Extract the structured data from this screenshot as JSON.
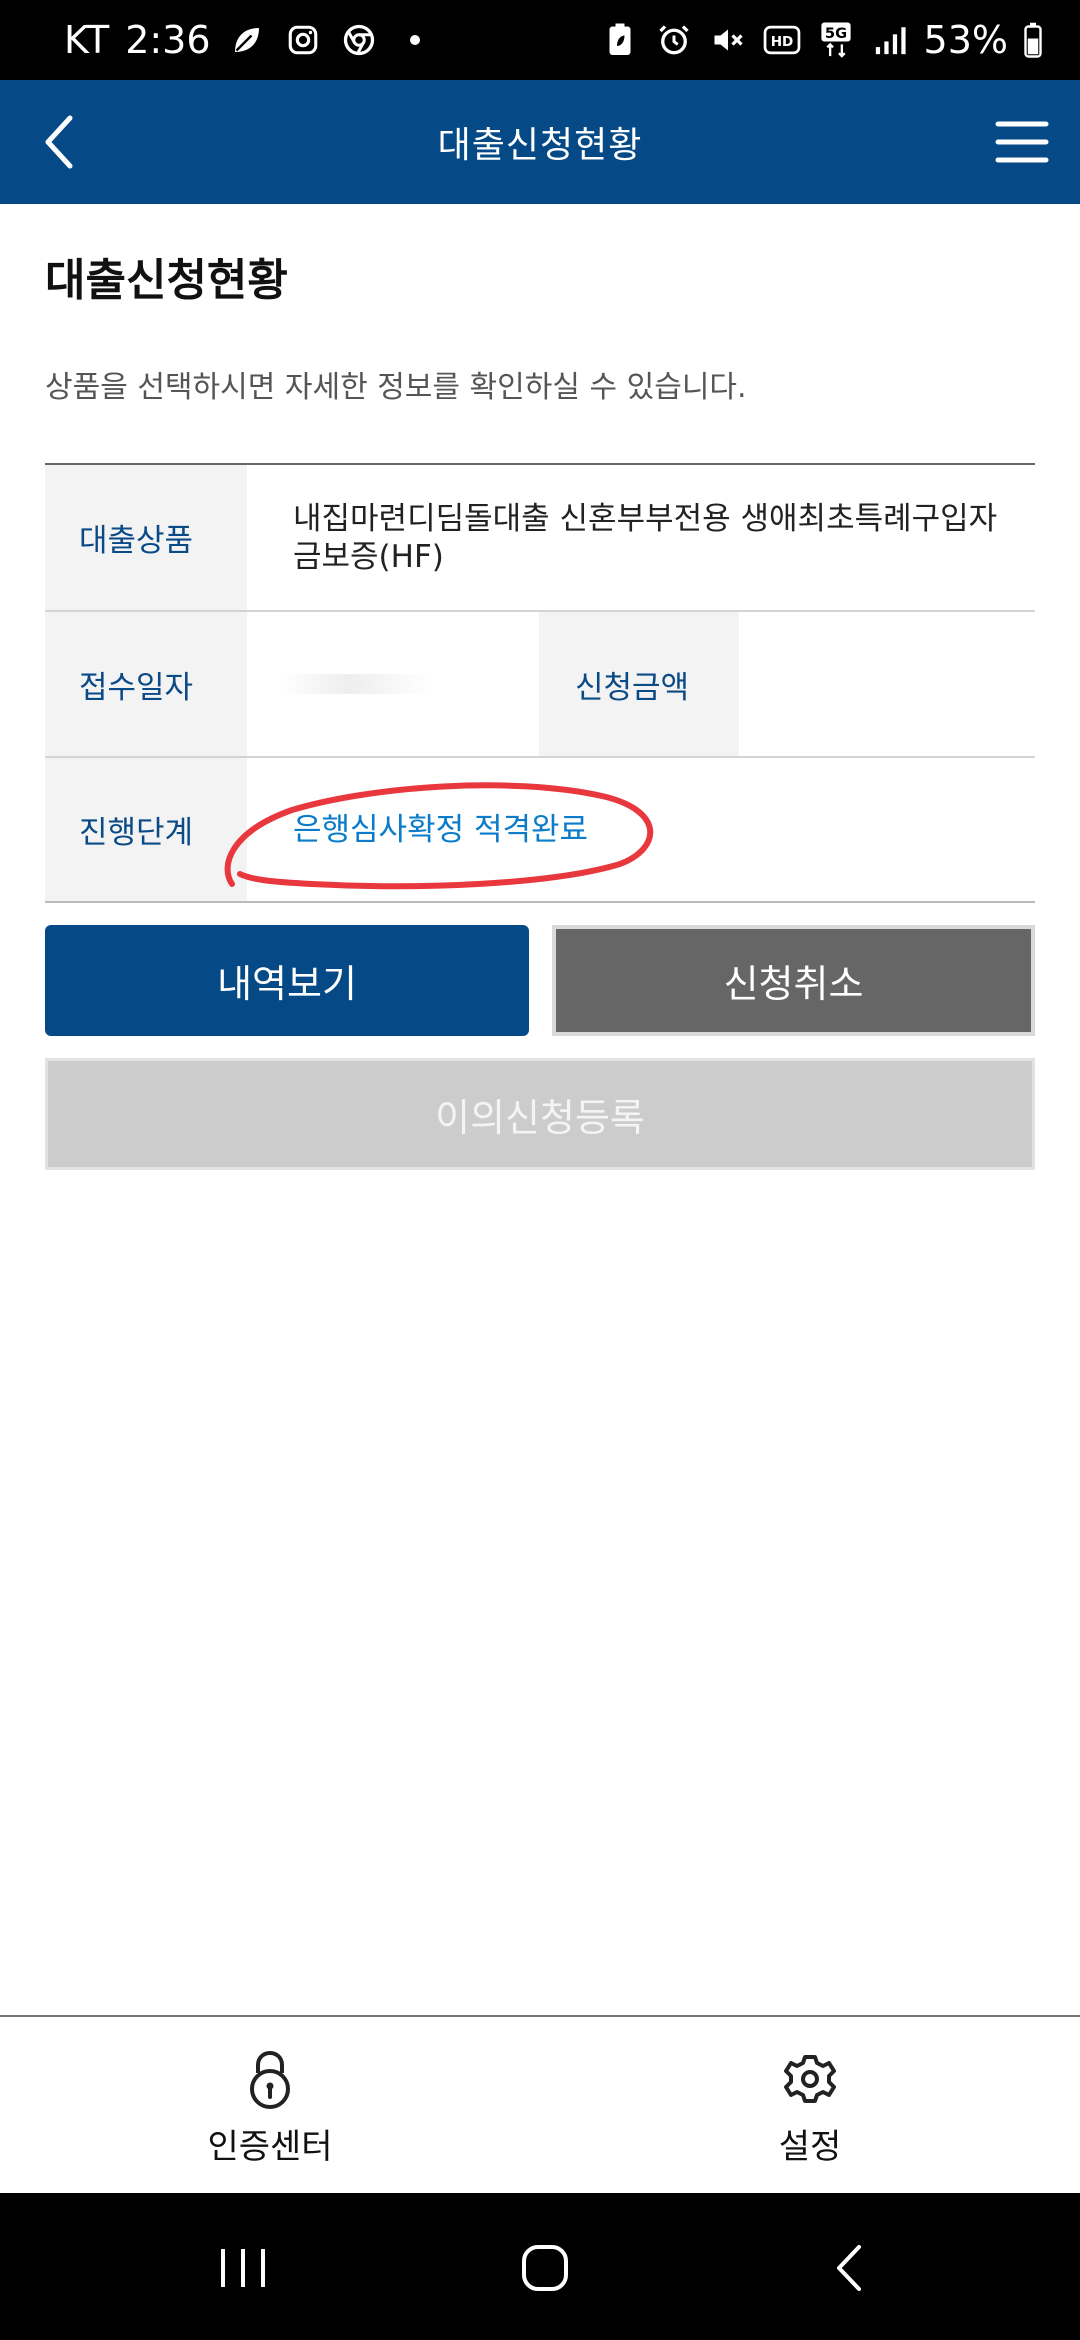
{
  "status_bar": {
    "carrier": "KT",
    "time": "2:36",
    "battery": "53%",
    "left_icons": [
      "leaf-icon",
      "instagram-icon",
      "chrome-icon",
      "dot-icon"
    ],
    "right_icons": [
      "battery-saver-icon",
      "alarm-icon",
      "mute-icon",
      "hd-icon",
      "5g-icon",
      "signal-icon",
      "battery-icon"
    ]
  },
  "header": {
    "title": "대출신청현황",
    "back_icon": "chevron-left-icon",
    "menu_icon": "hamburger-menu-icon"
  },
  "page": {
    "title": "대출신청현황",
    "description": "상품을 선택하시면 자세한 정보를 확인하실 수 있습니다."
  },
  "details": {
    "product_label": "대출상품",
    "product_value": "내집마련디딤돌대출 신혼부부전용 생애최초특례구입자금보증(HF)",
    "received_label": "접수일자",
    "amount_label": "신청금액",
    "stage_label": "진행단계",
    "stage_value": "은행심사확정 적격완료"
  },
  "buttons": {
    "history": "내역보기",
    "cancel": "신청취소",
    "appeal": "이의신청등록"
  },
  "bottom_nav": {
    "auth_center": "인증센터",
    "settings": "설정"
  },
  "colors": {
    "brand": "#054a86",
    "status_link": "#0a7cc9",
    "annotation": "#e8383d",
    "cancel_button": "#666666",
    "disabled_button": "#cccccc"
  }
}
